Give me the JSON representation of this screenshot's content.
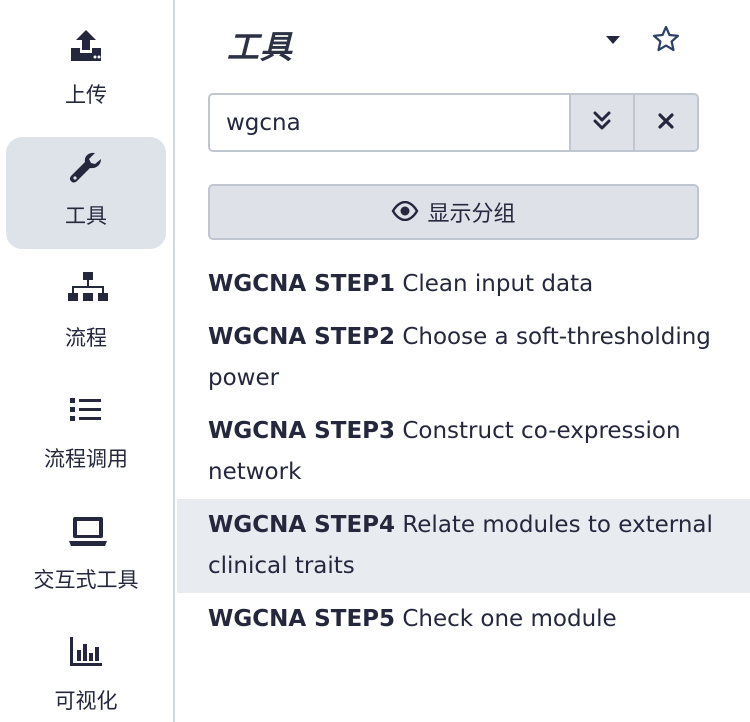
{
  "activity_bar": {
    "items": [
      {
        "label": "上传",
        "icon": "upload-icon"
      },
      {
        "label": "工具",
        "icon": "wrench-icon",
        "active": true
      },
      {
        "label": "流程",
        "icon": "sitemap-icon"
      },
      {
        "label": "流程调用",
        "icon": "list-icon"
      },
      {
        "label": "交互式工具",
        "icon": "laptop-icon"
      },
      {
        "label": "可视化",
        "icon": "chart-bar-icon"
      }
    ]
  },
  "panel": {
    "title": "工具",
    "search": {
      "value": "wgcna",
      "placeholder": ""
    },
    "show_groups_label": "显示分组"
  },
  "tools": [
    {
      "name": "WGCNA STEP1",
      "desc": "Clean input data"
    },
    {
      "name": "WGCNA STEP2",
      "desc": "Choose a soft-thresholding power"
    },
    {
      "name": "WGCNA STEP3",
      "desc": "Construct co-expression network"
    },
    {
      "name": "WGCNA STEP4",
      "desc": "Relate modules to external clinical traits"
    },
    {
      "name": "WGCNA STEP5",
      "desc": "Check one module"
    }
  ],
  "colors": {
    "accent": "#25283d",
    "active_bg": "#dee3ea",
    "hover_bg": "#e8ebef",
    "button_bg": "#dee2e8"
  }
}
